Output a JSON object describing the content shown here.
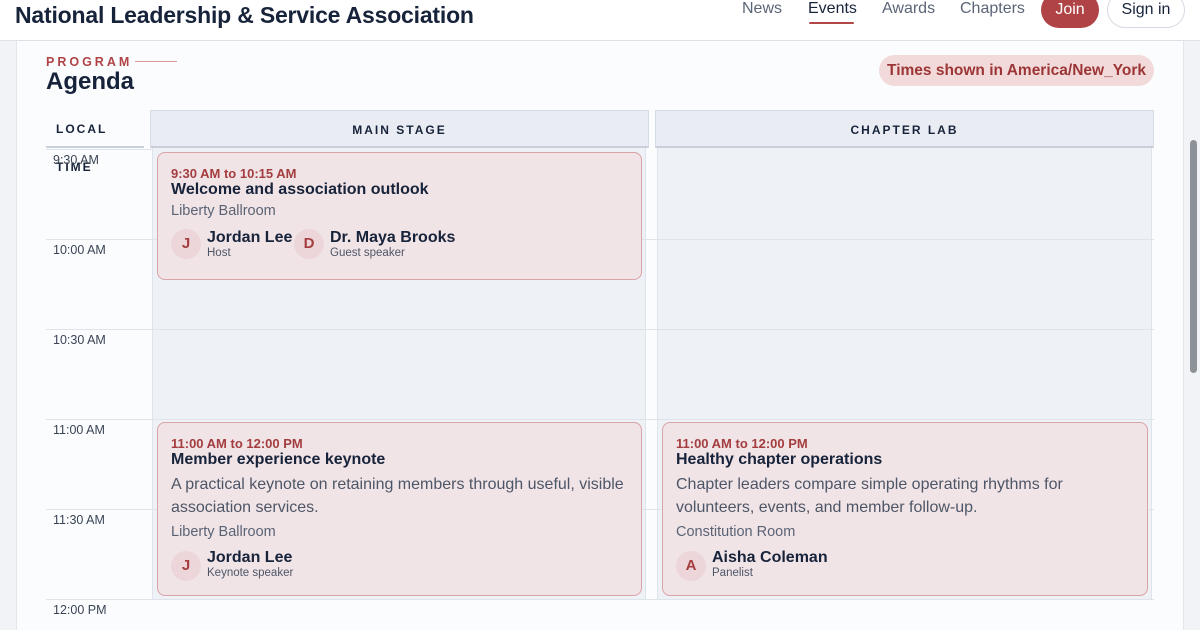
{
  "header": {
    "brand": "National Leadership & Service Association",
    "nav": [
      "News",
      "Events",
      "Awards",
      "Chapters"
    ],
    "active_nav": "Events",
    "join_label": "Join",
    "signin_label": "Sign in"
  },
  "section": {
    "eyebrow": "PROGRAM",
    "title": "Agenda",
    "timezone_badge": "Times shown in America/New_York"
  },
  "columns": {
    "time": "LOCAL TIME",
    "main": "MAIN STAGE",
    "lab": "CHAPTER LAB"
  },
  "time_slots": [
    "9:30 AM",
    "10:00 AM",
    "10:30 AM",
    "11:00 AM",
    "11:30 AM",
    "12:00 PM"
  ],
  "sessions": {
    "welcome": {
      "time": "9:30 AM to 10:15 AM",
      "title": "Welcome and association outlook",
      "room": "Liberty Ballroom",
      "people": [
        {
          "initial": "J",
          "name": "Jordan Lee",
          "role": "Host"
        },
        {
          "initial": "D",
          "name": "Dr. Maya Brooks",
          "role": "Guest speaker"
        }
      ]
    },
    "keynote": {
      "time": "11:00 AM to 12:00 PM",
      "title": "Member experience keynote",
      "description": "A practical keynote on retaining members through useful, visible association services.",
      "room": "Liberty Ballroom",
      "people": [
        {
          "initial": "J",
          "name": "Jordan Lee",
          "role": "Keynote speaker"
        }
      ]
    },
    "operations": {
      "time": "11:00 AM to 12:00 PM",
      "title": "Healthy chapter operations",
      "description": "Chapter leaders compare simple operating rhythms for volunteers, events, and member follow-up.",
      "room": "Constitution Room",
      "people": [
        {
          "initial": "A",
          "name": "Aisha Coleman",
          "role": "Panelist"
        }
      ]
    }
  },
  "colors": {
    "accent": "#b04345",
    "session_bg": "#f1e4e7",
    "session_border": "#d9a3a7"
  }
}
